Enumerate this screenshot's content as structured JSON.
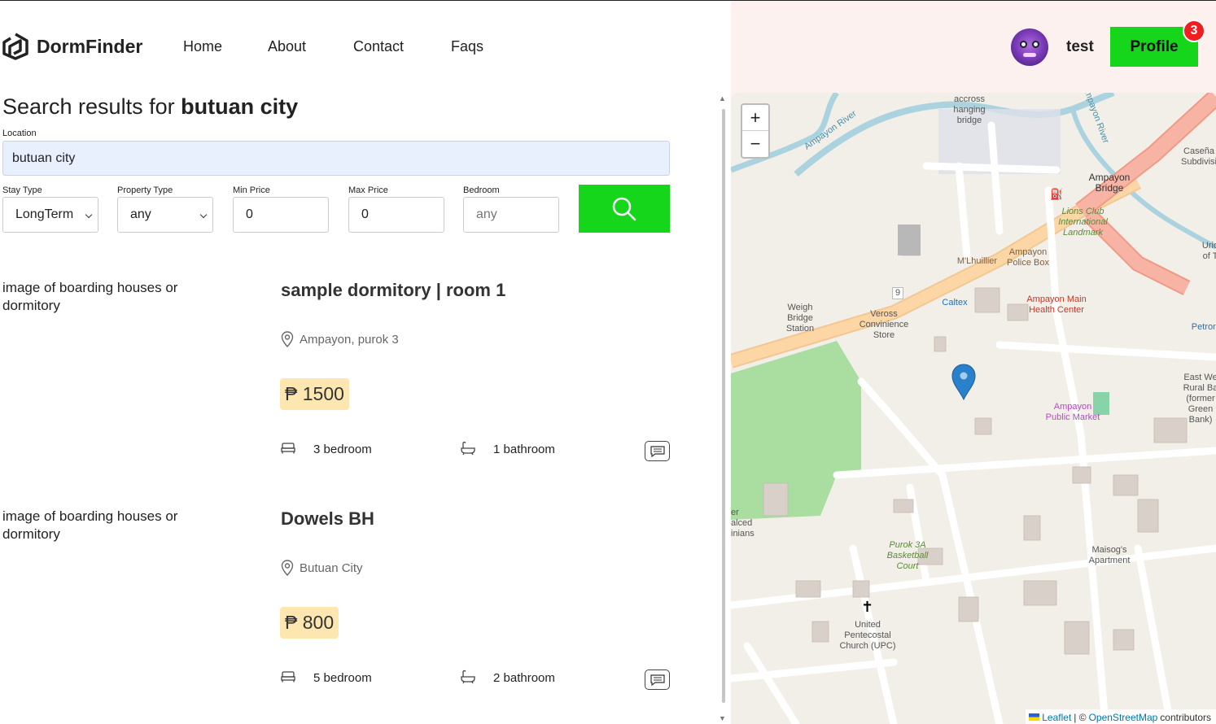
{
  "header": {
    "brand": "DormFinder",
    "nav": [
      "Home",
      "About",
      "Contact",
      "Faqs"
    ],
    "username": "test",
    "profile_label": "Profile",
    "notification_count": "3"
  },
  "search": {
    "title_prefix": "Search results for",
    "query": "butuan city",
    "location_label": "Location",
    "location_value": "butuan city",
    "filters": {
      "stay_type_label": "Stay Type",
      "stay_type_value": "LongTerm",
      "property_type_label": "Property Type",
      "property_type_value": "any",
      "min_price_label": "Min Price",
      "min_price_value": "0",
      "max_price_label": "Max Price",
      "max_price_value": "0",
      "bedroom_label": "Bedroom",
      "bedroom_placeholder": "any"
    }
  },
  "listings": [
    {
      "img_alt": "image of boarding houses or dormitory",
      "title": "sample dormitory | room 1",
      "location": "Ampayon, purok 3",
      "price": "₱ 1500",
      "bedrooms": "3 bedroom",
      "bathrooms": "1 bathroom"
    },
    {
      "img_alt": "image of boarding houses or dormitory",
      "title": "Dowels BH",
      "location": "Butuan City",
      "price": "₱ 800",
      "bedrooms": "5 bedroom",
      "bathrooms": "2 bathroom"
    }
  ],
  "map": {
    "zoom_in": "+",
    "zoom_out": "−",
    "attribution_leaflet": "Leaflet",
    "attribution_sep": "| ©",
    "attribution_osm": "OpenStreetMap",
    "attribution_tail": "contributors",
    "labels": {
      "bridge": "Ampayon Bridge",
      "hanging": "accross hanging bridge",
      "river1": "Ampayon River",
      "river2": "Ampayon River",
      "lions": "Lions Club International Landmark",
      "police": "Ampayon Police Box",
      "mlhuillier": "M'Lhuillier",
      "caltex": "Caltex",
      "health": "Ampayon Main Health Center",
      "weigh": "Weigh Bridge Station",
      "veross": "Veross Convinience Store",
      "market": "Ampayon Public Market",
      "eastwest": "East We Rural Ba (former Green Bank)",
      "petron": "Petron",
      "casena": "Caseña Subdivisi",
      "urios": "Urio of T",
      "purok": "Purok 3A Basketball Court",
      "maisog": "Maisog's Apartment",
      "church": "United Pentecostal Church (UPC)",
      "left_partial": "er alced inians",
      "route": "9"
    }
  }
}
